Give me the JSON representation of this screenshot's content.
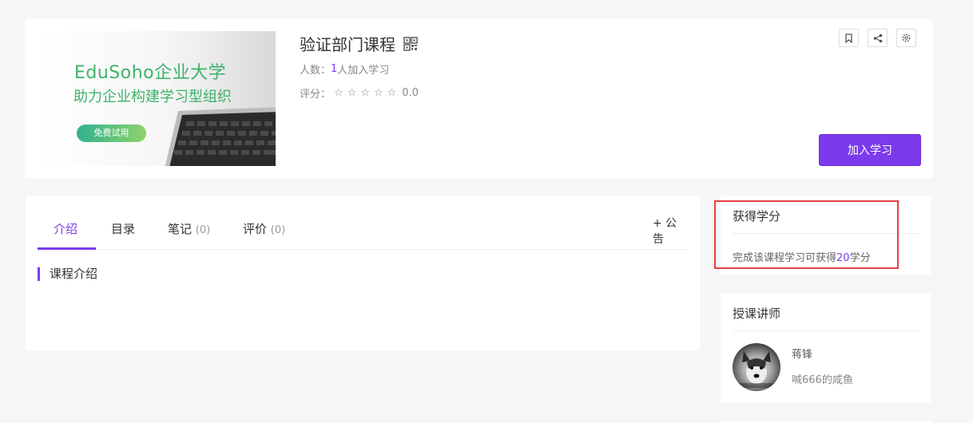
{
  "course": {
    "cover": {
      "line1": "EduSoho企业大学",
      "line2": "助力企业构建学习型组织",
      "pill": "免费试用"
    },
    "title": "验证部门课程",
    "students_label": "人数：",
    "students_count": "1",
    "students_suffix": "人加入学习",
    "rating_label": "评分：",
    "rating_stars": "☆☆☆☆☆",
    "rating_value": "0.0",
    "join_label": "加入学习",
    "icons": [
      "bookmark-icon",
      "share-icon",
      "settings-icon",
      "qrcode-icon"
    ]
  },
  "tabs": [
    {
      "label": "介绍",
      "count": ""
    },
    {
      "label": "目录",
      "count": ""
    },
    {
      "label": "笔记",
      "count": "(0)"
    },
    {
      "label": "评价",
      "count": "(0)"
    }
  ],
  "notice_label": "+ 公告",
  "intro_heading": "课程介绍",
  "credits": {
    "title": "获得学分",
    "text_prefix": "完成该课程学习可获得",
    "value": "20",
    "text_suffix": "学分"
  },
  "teacher": {
    "section_title": "授课讲师",
    "name": "蒋锋",
    "bio": "喊666的咸鱼"
  },
  "colors": {
    "accent": "#7c3aed",
    "highlight_box": "#e53e3e",
    "cover_text": "#3db26a"
  }
}
